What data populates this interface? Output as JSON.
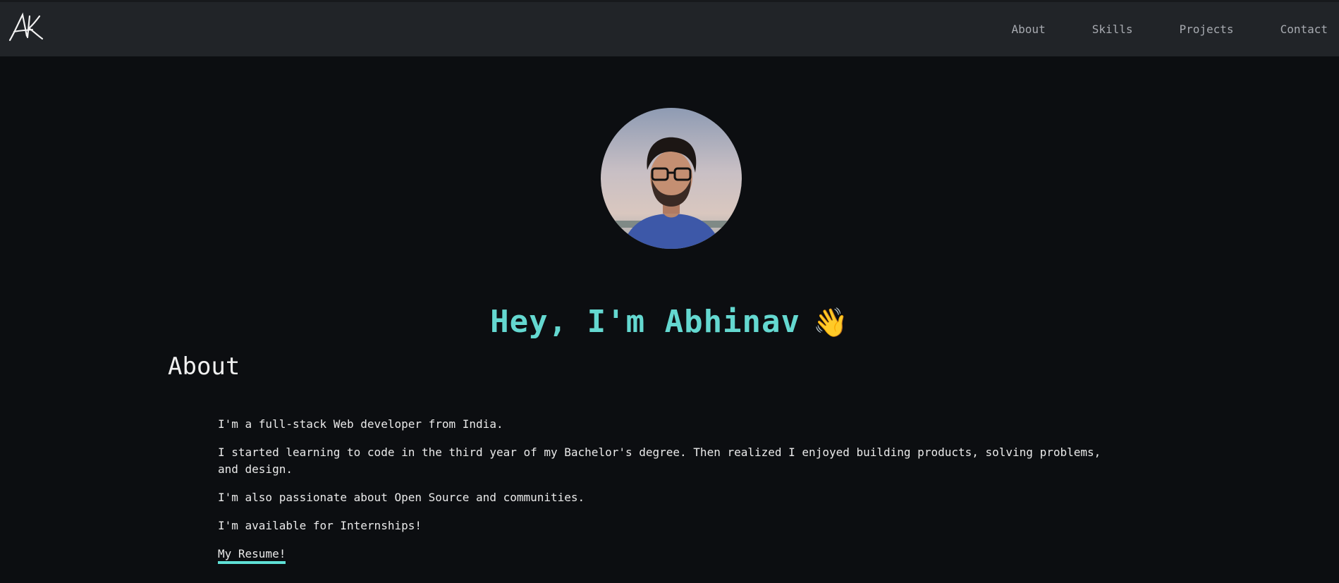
{
  "brand": {
    "logo_text": "AK"
  },
  "nav": {
    "items": [
      {
        "label": "About"
      },
      {
        "label": "Skills"
      },
      {
        "label": "Projects"
      },
      {
        "label": "Contact"
      }
    ]
  },
  "hero": {
    "greeting": "Hey, I'm Abhinav",
    "wave": "👋",
    "avatar_icon": "person-avatar"
  },
  "about": {
    "title": "About",
    "paragraphs": [
      "I'm a full-stack Web developer from India.",
      "I started learning to code in the third year of my Bachelor's degree. Then realized I enjoyed building products, solving problems, and design.",
      "I'm also passionate about Open Source and communities.",
      "I'm available for Internships!"
    ],
    "resume_label": "My Resume!"
  },
  "colors": {
    "background": "#0c0e11",
    "topbar": "#212428",
    "accent": "#64d8d0",
    "underline": "#5fe0d6"
  }
}
